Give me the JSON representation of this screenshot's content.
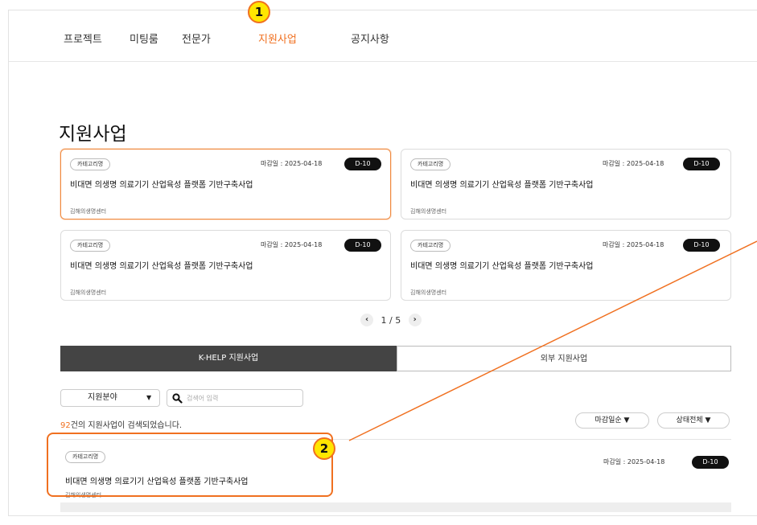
{
  "nav": {
    "items": [
      {
        "label": "프로젝트",
        "active": false
      },
      {
        "label": "미팅룸",
        "active": false
      },
      {
        "label": "전문가",
        "active": false
      },
      {
        "label": "지원사업",
        "active": true
      },
      {
        "label": "공지사항",
        "active": false
      }
    ]
  },
  "page": {
    "title": "지원사업"
  },
  "cards": [
    {
      "category": "카테고리명",
      "deadline": "마감일 : 2025-04-18",
      "dday": "D-10",
      "title": "비대면 의생명 의료기기 산업육성 플랫폼 기반구축사업",
      "org": "김해의생명센터"
    },
    {
      "category": "카테고리명",
      "deadline": "마감일 : 2025-04-18",
      "dday": "D-10",
      "title": "비대면 의생명 의료기기 산업육성 플랫폼 기반구축사업",
      "org": "김해의생명센터"
    },
    {
      "category": "카테고리명",
      "deadline": "마감일 : 2025-04-18",
      "dday": "D-10",
      "title": "비대면 의생명 의료기기 산업육성 플랫폼 기반구축사업",
      "org": "김해의생명센터"
    },
    {
      "category": "카테고리명",
      "deadline": "마감일 : 2025-04-18",
      "dday": "D-10",
      "title": "비대면 의생명 의료기기 산업육성 플랫폼 기반구축사업",
      "org": "김해의생명센터"
    }
  ],
  "pager": {
    "prev_icon": "chevron-left-icon",
    "text": "1 / 5",
    "next_icon": "chevron-right-icon"
  },
  "tabs": {
    "internal": "K-HELP 지원사업",
    "external": "외부 지원사업"
  },
  "filter": {
    "field_label": "지원분야",
    "caret": "▼",
    "search_placeholder": "검색어 입력",
    "search_icon": "search-icon"
  },
  "results": {
    "count": "92",
    "suffix": "건의 지원사업이 검색되었습니다."
  },
  "sort": {
    "deadline_label": "마감일순 ▼",
    "status_label": "상태전체 ▼"
  },
  "list": [
    {
      "category": "카테고리명",
      "deadline": "마감일 : 2025-04-18",
      "dday": "D-10",
      "title": "비대면 의생명 의료기기 산업육성 플랫폼 기반구축사업",
      "org": "김해의생명센터"
    }
  ],
  "annotations": {
    "badge_1": "1",
    "badge_2": "2"
  },
  "colors": {
    "accent": "#f07020",
    "badge_fill": "#ffe600",
    "tab_active": "#444444",
    "dday_bg": "#111111"
  }
}
